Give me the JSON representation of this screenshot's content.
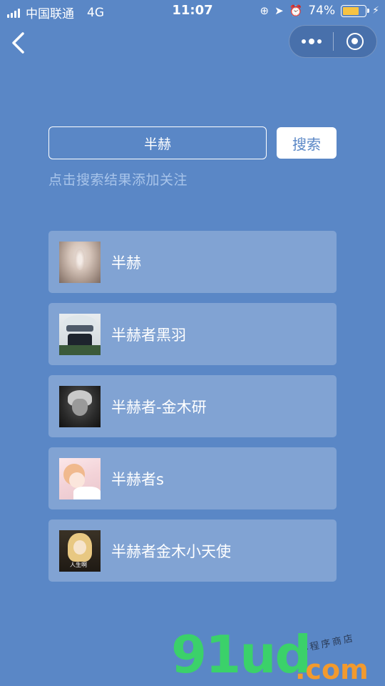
{
  "status_bar": {
    "carrier": "中国联通",
    "network": "4G",
    "time": "11:07",
    "battery_percent": "74%",
    "battery_level": 0.74,
    "battery_color": "#f6c343"
  },
  "nav": {
    "back_icon": "chevron-left-icon",
    "more_icon": "more-dots-icon",
    "close_icon": "target-circle-icon"
  },
  "search": {
    "value": "半赫",
    "button_label": "搜索"
  },
  "hint": "点击搜索结果添加关注",
  "results": [
    {
      "name": "半赫"
    },
    {
      "name": "半赫者黑羽"
    },
    {
      "name": "半赫者-金木研"
    },
    {
      "name": "半赫者s"
    },
    {
      "name": "半赫者金木小天使",
      "avatar_caption": "人生啊"
    }
  ],
  "watermark": {
    "brand": "91ud",
    "domain": ".com",
    "tagline": "小程序商店"
  },
  "colors": {
    "background": "#5a87c6",
    "hint_text": "#a8c4ea",
    "brand_green": "#3bd16a",
    "brand_orange": "#f29a2e"
  }
}
